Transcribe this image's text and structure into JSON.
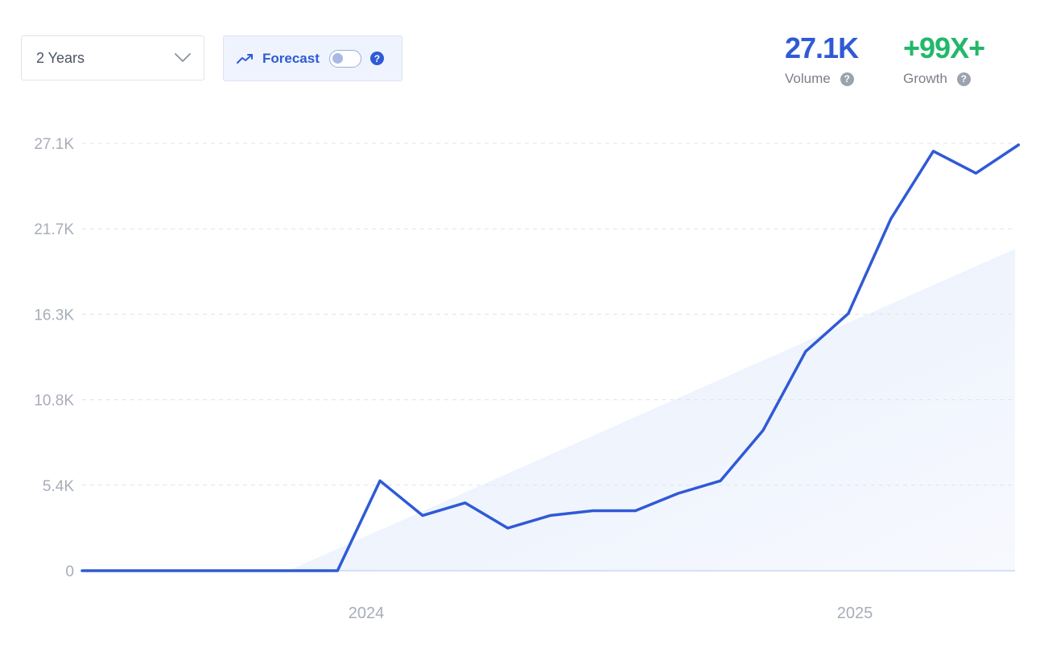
{
  "controls": {
    "range_label": "2 Years",
    "forecast_label": "Forecast",
    "forecast_enabled": false,
    "help_glyph": "?"
  },
  "stats": {
    "volume_value": "27.1K",
    "volume_label": "Volume",
    "growth_value": "+99X+",
    "growth_label": "Growth"
  },
  "colors": {
    "line": "#2f5ad6",
    "growth": "#22b86a",
    "trend_fill": "#e9f0fc"
  },
  "chart_data": {
    "type": "line",
    "y_tick_labels": [
      "0",
      "5.4K",
      "10.8K",
      "16.3K",
      "21.7K",
      "27.1K"
    ],
    "ylim": [
      0,
      27100
    ],
    "x_tick_labels": [
      "2024",
      "2025"
    ],
    "grid": "horizontal-dashed",
    "series": [
      {
        "values": [
          0,
          0,
          0,
          0,
          0,
          0,
          0,
          5700,
          3500,
          4300,
          2700,
          3500,
          3800,
          3800,
          4900,
          5700,
          8900,
          13900,
          16300,
          22300,
          26600,
          25200,
          27000
        ]
      }
    ],
    "trend_end_value": 20400
  }
}
